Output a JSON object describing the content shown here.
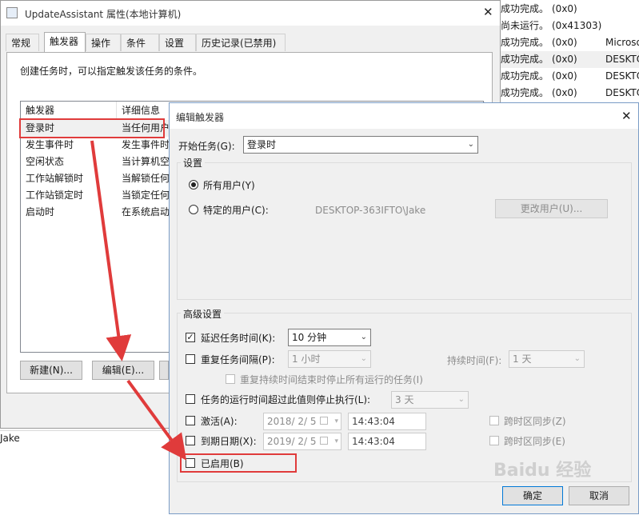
{
  "background_list": {
    "rows": [
      {
        "status": "成功完成。",
        "code": "(0x0)",
        "author": ""
      },
      {
        "status": "尚未运行。",
        "code": "(0x41303)",
        "author": ""
      },
      {
        "status": "成功完成。",
        "code": "(0x0)",
        "author": "Microso"
      },
      {
        "status": "成功完成。",
        "code": "(0x0)",
        "author": "DESKTO"
      },
      {
        "status": "成功完成。",
        "code": "(0x0)",
        "author": "DESKTO"
      },
      {
        "status": "成功完成。",
        "code": "(0x0)",
        "author": "DESKTO"
      }
    ],
    "bottom_user": "Jake"
  },
  "props_window": {
    "title": "UpdateAssistant 属性(本地计算机)",
    "tabs": [
      "常规",
      "触发器",
      "操作",
      "条件",
      "设置",
      "历史记录(已禁用)"
    ],
    "hint": "创建任务时，可以指定触发该任务的条件。",
    "columns": [
      "触发器",
      "详细信息"
    ],
    "rows": [
      {
        "trigger": "登录时",
        "detail": "当任何用户"
      },
      {
        "trigger": "发生事件时",
        "detail": "发生事件时"
      },
      {
        "trigger": "空闲状态",
        "detail": "当计算机空"
      },
      {
        "trigger": "工作站解锁时",
        "detail": "当解锁任何"
      },
      {
        "trigger": "工作站锁定时",
        "detail": "当锁定任何"
      },
      {
        "trigger": "启动时",
        "detail": "在系统启动"
      }
    ],
    "new_button": "新建(N)...",
    "edit_button": "编辑(E)..."
  },
  "edit_dialog": {
    "title": "编辑触发器",
    "begin_label": "开始任务(G):",
    "begin_value": "登录时",
    "settings_group": "设置",
    "all_users": "所有用户(Y)",
    "specific_user": "特定的用户(C):",
    "user_name": "DESKTOP-363IFTO\\Jake",
    "change_user": "更改用户(U)...",
    "advanced_group": "高级设置",
    "delay_label": "延迟任务时间(K):",
    "delay_value": "10 分钟",
    "repeat_label": "重复任务间隔(P):",
    "repeat_value": "1 小时",
    "duration_label": "持续时间(F):",
    "duration_value": "1 天",
    "stop_all": "重复持续时间结束时停止所有运行的任务(I)",
    "stop_longer": "任务的运行时间超过此值则停止执行(L):",
    "stop_longer_value": "3 天",
    "activate_label": "激活(A):",
    "activate_date": "2018/ 2/ 5",
    "activate_time": "14:43:04",
    "sync_tz_1": "跨时区同步(Z)",
    "expire_label": "到期日期(X):",
    "expire_date": "2019/ 2/ 5",
    "expire_time": "14:43:04",
    "sync_tz_2": "跨时区同步(E)",
    "enabled_label": "已启用(B)",
    "ok_button": "确定",
    "cancel_button": "取消"
  },
  "watermark": "Baidu 经验",
  "colors": {
    "highlight": "#e03b3b",
    "dialog_bg": "#f0f0f0",
    "selected_row": "#f0f0f0"
  }
}
